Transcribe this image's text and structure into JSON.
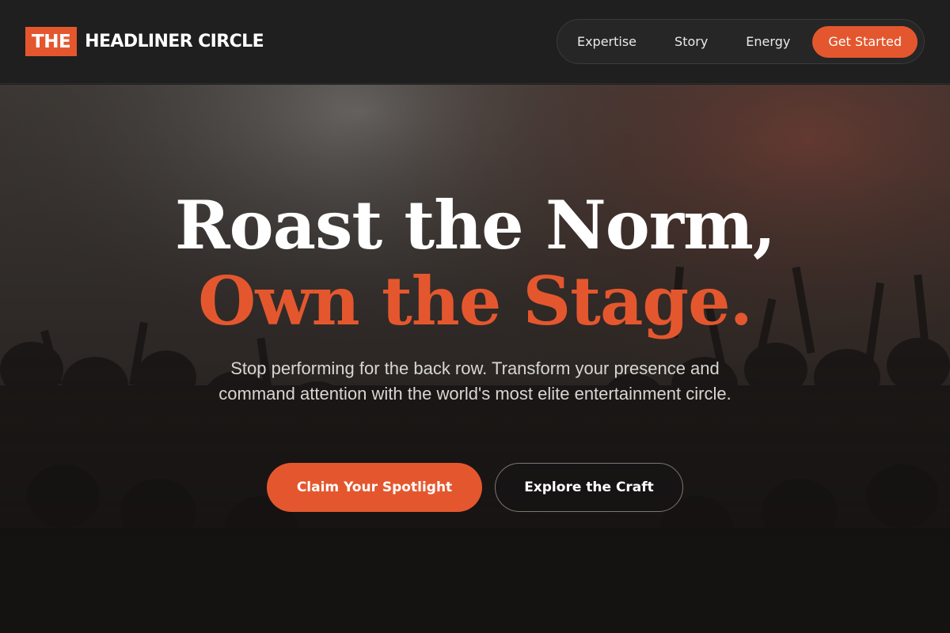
{
  "brand": {
    "logo_box": "THE",
    "logo_text": "HEADLINER CIRCLE",
    "accent_color": "#e4572e"
  },
  "nav": {
    "links": [
      {
        "label": "Expertise"
      },
      {
        "label": "Story"
      },
      {
        "label": "Energy"
      }
    ],
    "cta_label": "Get Started"
  },
  "hero": {
    "headline_line1": "Roast the Norm,",
    "headline_line2": "Own the Stage.",
    "subtitle": "Stop performing for the back row. Transform your presence and command attention with the world's most elite entertainment circle.",
    "primary_button": "Claim Your Spotlight",
    "secondary_button": "Explore the Craft",
    "background_image": "concert-crowd-silhouette"
  }
}
